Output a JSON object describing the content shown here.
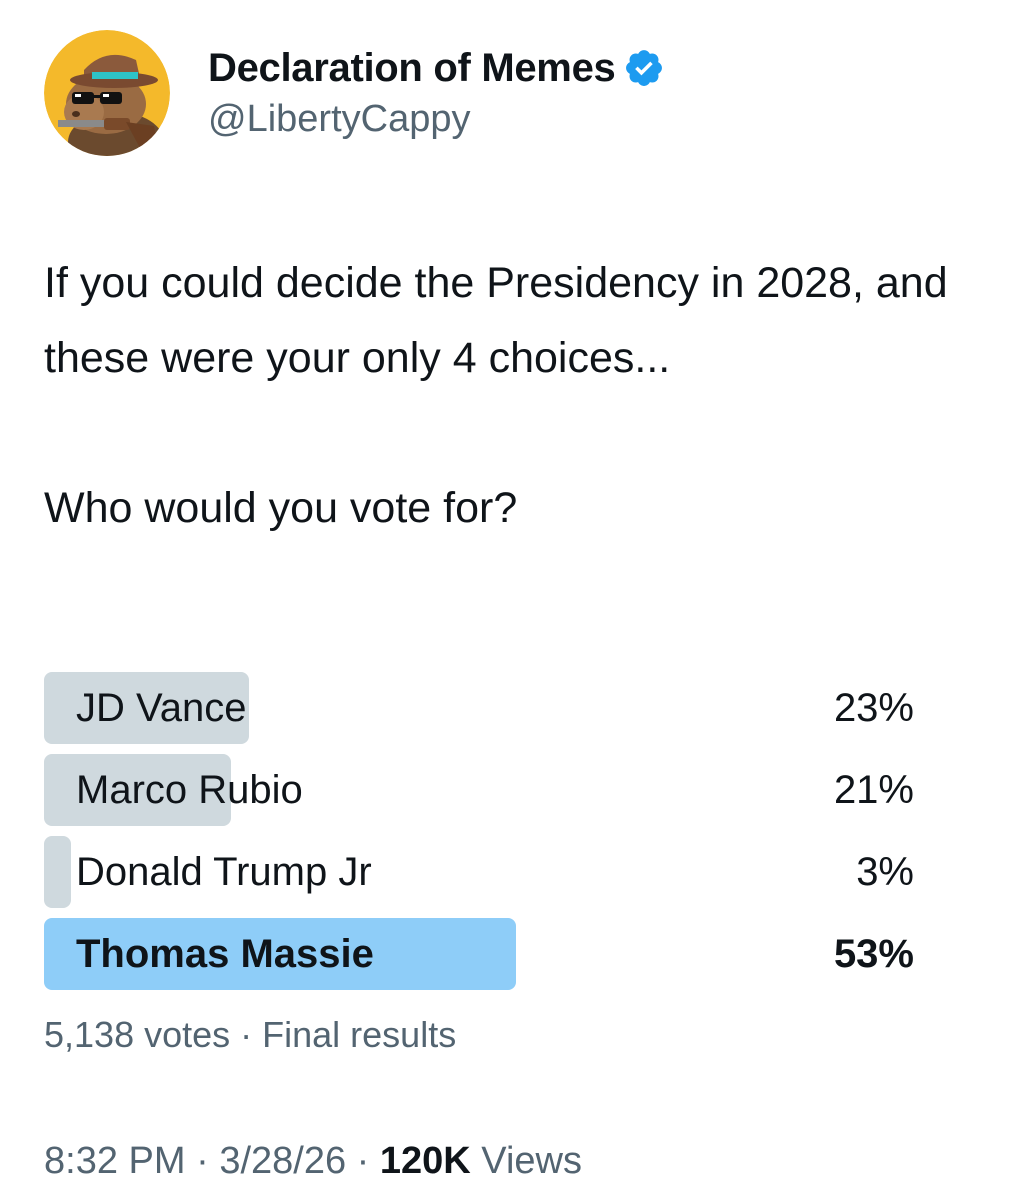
{
  "account": {
    "display_name": "Declaration of Memes",
    "handle": "@LibertyCappy",
    "verified_color": "#1d9bf0"
  },
  "tweet": {
    "text_paragraph_1": "If you could decide the Presidency in 2028, and these were your only 4 choices...",
    "text_paragraph_2": "Who would you vote for?"
  },
  "poll": {
    "options": [
      {
        "label": "JD Vance",
        "percent_label": "23%",
        "percent": 23,
        "winner": false
      },
      {
        "label": "Marco Rubio",
        "percent_label": "21%",
        "percent": 21,
        "winner": false
      },
      {
        "label": "Donald Trump Jr",
        "percent_label": "3%",
        "percent": 3,
        "winner": false
      },
      {
        "label": "Thomas Massie",
        "percent_label": "53%",
        "percent": 53,
        "winner": true
      }
    ],
    "votes": "5,138 votes",
    "separator": " · ",
    "status": "Final results",
    "bar_color": "#cfd9de",
    "winner_color": "#8ecdf8"
  },
  "meta": {
    "time": "8:32 PM",
    "date": "3/28/26",
    "separator": " · ",
    "views_count": "120K",
    "views_label": " Views"
  }
}
